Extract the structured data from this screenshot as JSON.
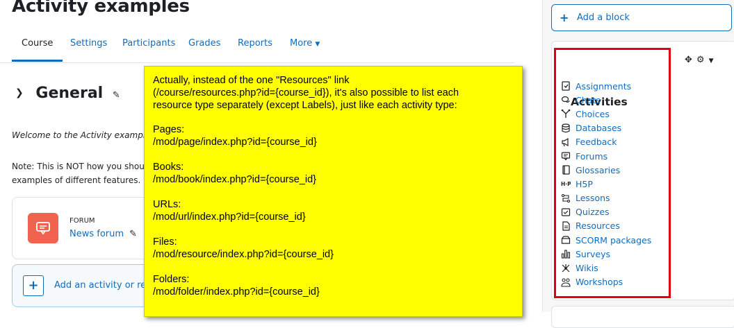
{
  "page": {
    "title": "Activity examples",
    "tabs": [
      {
        "label": "Course",
        "active": true
      },
      {
        "label": "Settings"
      },
      {
        "label": "Participants"
      },
      {
        "label": "Grades"
      },
      {
        "label": "Reports"
      },
      {
        "label": "More"
      }
    ]
  },
  "section": {
    "title": "General",
    "welcome": "Welcome to the Activity examples",
    "note": "Note: This is NOT how you shoul examples of different features."
  },
  "forum_card": {
    "type": "FORUM",
    "name": "News forum"
  },
  "add_activity": {
    "label": "Add an activity or reso"
  },
  "sticky_note": {
    "intro": "Actually, instead of the one \"Resources\" link\n(/course/resources.php?id={course_id}), it's also possible to list each\nresource type separately (except Labels), just like each activity type:",
    "entries": [
      {
        "name": "Pages:",
        "url": "/mod/page/index.php?id={course_id}"
      },
      {
        "name": "Books:",
        "url": "/mod/book/index.php?id={course_id}"
      },
      {
        "name": "URLs:",
        "url": "/mod/url/index.php?id={course_id}"
      },
      {
        "name": "Files:",
        "url": "/mod/resource/index.php?id={course_id}"
      },
      {
        "name": "Folders:",
        "url": "/mod/folder/index.php?id={course_id}"
      }
    ]
  },
  "drawer": {
    "add_block_label": "Add a block",
    "block_title": "Activities",
    "activities": [
      {
        "label": "Assignments",
        "icon": "assignment-icon"
      },
      {
        "label": "Chats",
        "icon": "chat-icon"
      },
      {
        "label": "Choices",
        "icon": "choice-icon"
      },
      {
        "label": "Databases",
        "icon": "database-icon"
      },
      {
        "label": "Feedback",
        "icon": "feedback-icon"
      },
      {
        "label": "Forums",
        "icon": "forum-icon"
      },
      {
        "label": "Glossaries",
        "icon": "glossary-icon"
      },
      {
        "label": "H5P",
        "icon": "h5p-icon"
      },
      {
        "label": "Lessons",
        "icon": "lesson-icon"
      },
      {
        "label": "Quizzes",
        "icon": "quiz-icon"
      },
      {
        "label": "Resources",
        "icon": "resource-icon"
      },
      {
        "label": "SCORM packages",
        "icon": "scorm-icon"
      },
      {
        "label": "Surveys",
        "icon": "survey-icon"
      },
      {
        "label": "Wikis",
        "icon": "wiki-icon"
      },
      {
        "label": "Workshops",
        "icon": "workshop-icon"
      }
    ]
  },
  "colors": {
    "link": "#0f6cbf",
    "forum_icon_bg": "#f0644f",
    "sticky_bg": "#ffff00",
    "highlight": "#e0000f"
  }
}
